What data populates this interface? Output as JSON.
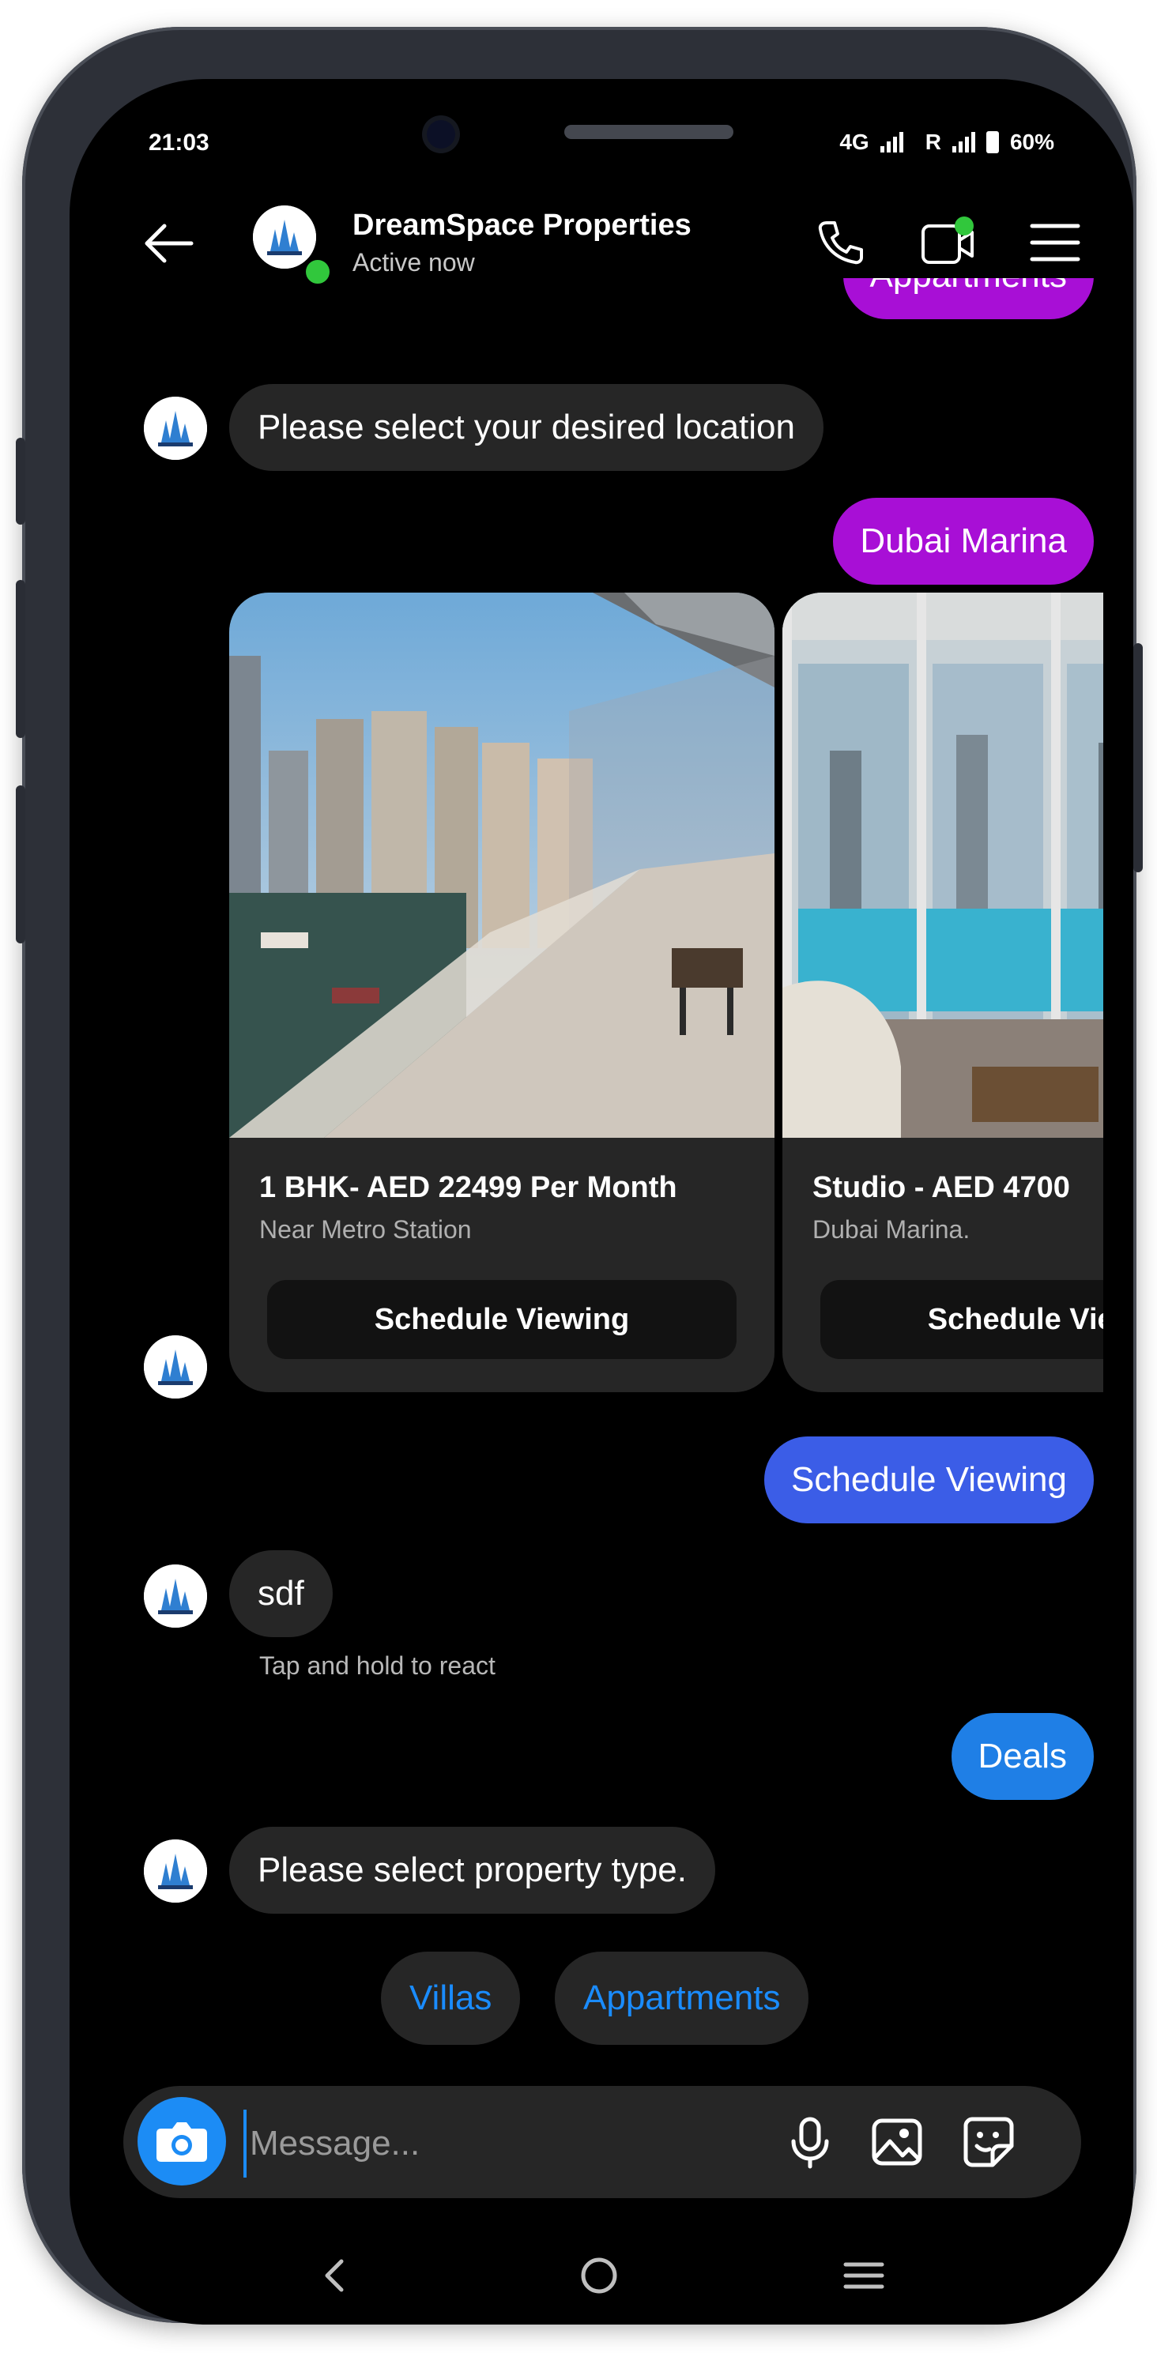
{
  "status_bar": {
    "time": "21:03",
    "network1": "4G",
    "network2": "R",
    "battery": "60%"
  },
  "header": {
    "name": "DreamSpace Properties",
    "status": "Active now"
  },
  "messages": {
    "partial_out": "Appartments",
    "location_prompt": "Please select your desired location",
    "dubai_marina": "Dubai Marina",
    "schedule_viewing": "Schedule Viewing",
    "sdf": "sdf",
    "hint": "Tap and hold to react",
    "deals": "Deals",
    "property_type_prompt": "Please select property type."
  },
  "cards": [
    {
      "title": "1 BHK- AED 22499 Per Month",
      "subtitle": "Near Metro Station",
      "button": "Schedule Viewing"
    },
    {
      "title": "Studio - AED 4700",
      "subtitle": "Dubai Marina.",
      "button": "Schedule Viewing"
    }
  ],
  "quick_replies": [
    "Villas",
    "Appartments"
  ],
  "composer": {
    "placeholder": "Message..."
  },
  "colors": {
    "accent_blue": "#1c8cf5",
    "purple": "#a80fd6",
    "indigo": "#3b5de7",
    "bubble_in": "#262626"
  },
  "icons": [
    "back-arrow-icon",
    "phone-icon",
    "video-call-icon",
    "menu-icon",
    "camera-icon",
    "mic-icon",
    "gallery-icon",
    "sticker-icon",
    "nav-back-icon",
    "nav-home-icon",
    "nav-recents-icon"
  ]
}
